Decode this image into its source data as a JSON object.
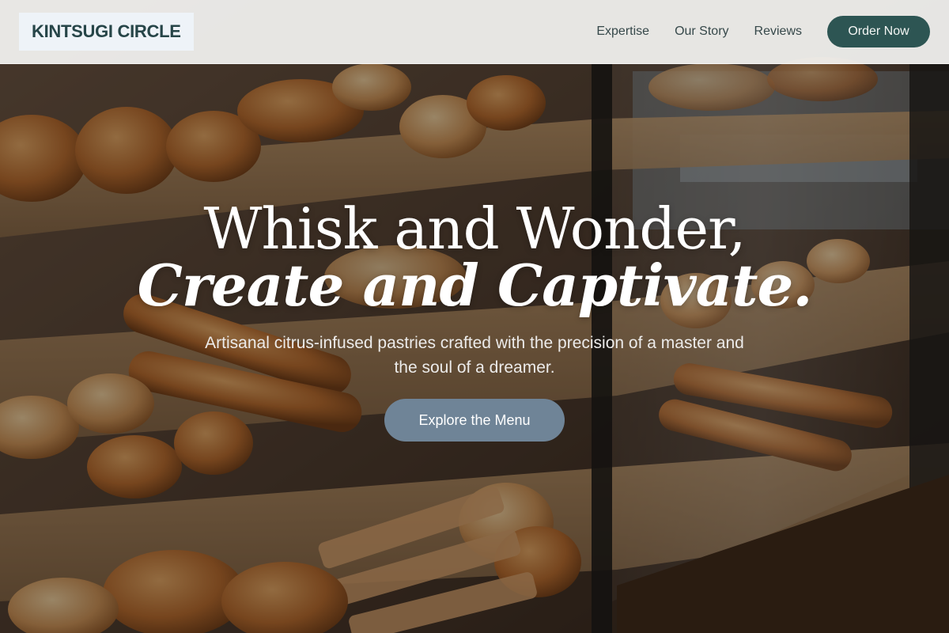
{
  "header": {
    "logo_text": "KINTSUGI CIRCLE",
    "nav": [
      {
        "label": "Expertise"
      },
      {
        "label": "Our Story"
      },
      {
        "label": "Reviews"
      }
    ],
    "cta_label": "Order Now"
  },
  "hero": {
    "headline_line1": "Whisk and Wonder,",
    "headline_line2": "Create and Captivate.",
    "subtitle": "Artisanal citrus-infused pastries crafted with the precision of a master and the soul of a dreamer.",
    "cta_label": "Explore the Menu",
    "background_image": "bakery-display-case-photo"
  },
  "colors": {
    "brand_dark_teal": "#2d5553",
    "cta_slate_blue": "#6f8497",
    "logo_text": "#264548",
    "header_bg": "#f4f4f2"
  }
}
